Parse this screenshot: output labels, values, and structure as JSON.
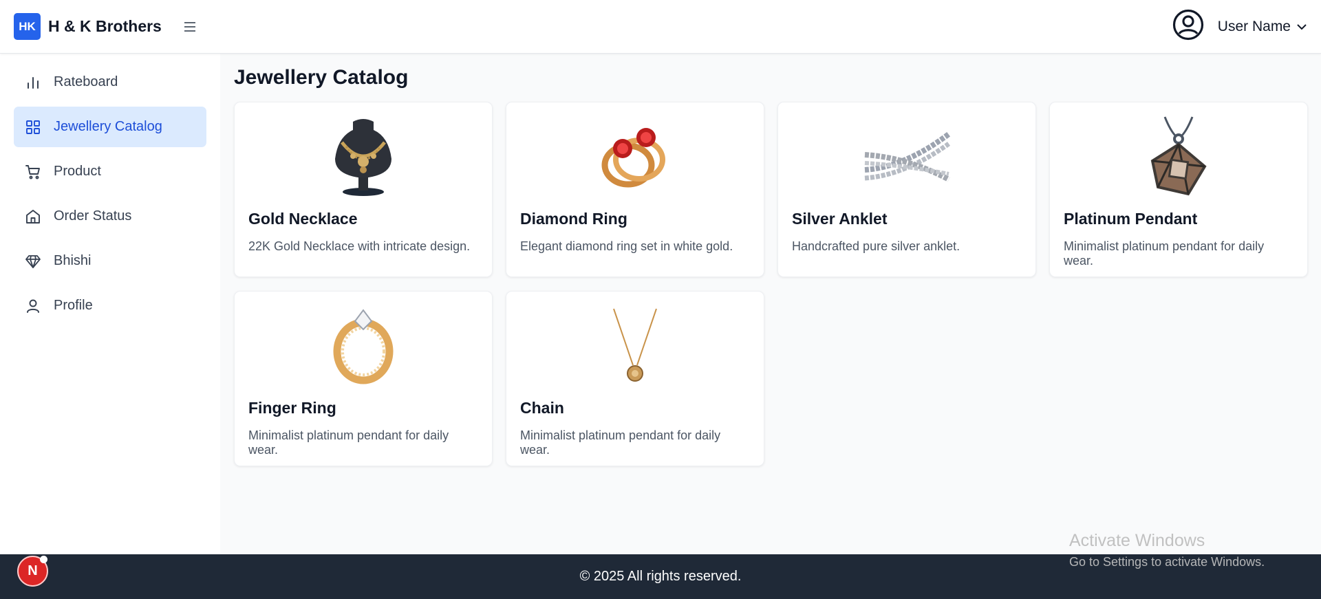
{
  "header": {
    "logo_text": "HK",
    "brand_name": "H & K Brothers",
    "user_name": "User Name"
  },
  "sidebar": {
    "items": [
      {
        "label": "Rateboard",
        "icon": "bar-chart-icon"
      },
      {
        "label": "Jewellery Catalog",
        "icon": "grid-icon",
        "active": true
      },
      {
        "label": "Product",
        "icon": "cart-icon"
      },
      {
        "label": "Order Status",
        "icon": "home-icon"
      },
      {
        "label": "Bhishi",
        "icon": "diamond-icon"
      },
      {
        "label": "Profile",
        "icon": "user-icon"
      }
    ]
  },
  "main": {
    "title": "Jewellery Catalog",
    "products": [
      {
        "name": "Gold Necklace",
        "description": "22K Gold Necklace with intricate design."
      },
      {
        "name": "Diamond Ring",
        "description": "Elegant diamond ring set in white gold."
      },
      {
        "name": "Silver Anklet",
        "description": "Handcrafted pure silver anklet."
      },
      {
        "name": "Platinum Pendant",
        "description": "Minimalist platinum pendant for daily wear."
      },
      {
        "name": "Finger Ring",
        "description": "Minimalist platinum pendant for daily wear."
      },
      {
        "name": "Chain",
        "description": "Minimalist platinum pendant for daily wear."
      }
    ]
  },
  "footer": {
    "text": "© 2025 All rights reserved."
  },
  "dev_badge": {
    "letter": "N"
  },
  "watermark": {
    "title": "Activate Windows",
    "subtitle": "Go to Settings to activate Windows."
  },
  "colors": {
    "accent": "#2563eb",
    "active_bg": "#dbeafe",
    "active_text": "#1d4ed8",
    "footer_bg": "#1f2937",
    "page_bg": "#f9fafb"
  }
}
